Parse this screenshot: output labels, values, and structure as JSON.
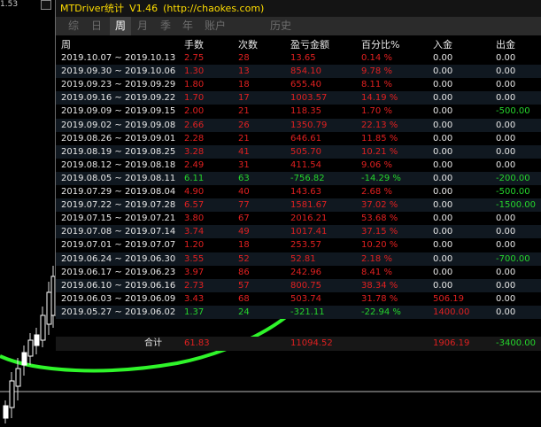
{
  "chart": {
    "price_label": "1.53"
  },
  "window": {
    "app_name": "MTDriver统计",
    "version": "V1.46",
    "url": "(http://chaokes.com)"
  },
  "tabs": [
    {
      "label": "综",
      "active": false
    },
    {
      "label": "日",
      "active": false
    },
    {
      "label": "周",
      "active": true
    },
    {
      "label": "月",
      "active": false
    },
    {
      "label": "季",
      "active": false
    },
    {
      "label": "年",
      "active": false
    },
    {
      "label": "账户",
      "active": false
    },
    {
      "label": "历史",
      "active": false
    }
  ],
  "table": {
    "headers": [
      "周",
      "手数",
      "次数",
      "盈亏金额",
      "百分比%",
      "入金",
      "出金"
    ],
    "rows": [
      {
        "period": "2019.10.07 ~ 2019.10.13",
        "lots": "2.75",
        "count": "28",
        "profit": "13.65",
        "pct": "0.14 %",
        "deposit": "0.00",
        "withdraw": "0.00",
        "sign": "pos"
      },
      {
        "period": "2019.09.30 ~ 2019.10.06",
        "lots": "1.30",
        "count": "13",
        "profit": "854.10",
        "pct": "9.78 %",
        "deposit": "0.00",
        "withdraw": "0.00",
        "sign": "pos"
      },
      {
        "period": "2019.09.23 ~ 2019.09.29",
        "lots": "1.80",
        "count": "18",
        "profit": "655.40",
        "pct": "8.11 %",
        "deposit": "0.00",
        "withdraw": "0.00",
        "sign": "pos"
      },
      {
        "period": "2019.09.16 ~ 2019.09.22",
        "lots": "1.70",
        "count": "17",
        "profit": "1003.57",
        "pct": "14.19 %",
        "deposit": "0.00",
        "withdraw": "0.00",
        "sign": "pos"
      },
      {
        "period": "2019.09.09 ~ 2019.09.15",
        "lots": "2.00",
        "count": "21",
        "profit": "118.35",
        "pct": "1.70 %",
        "deposit": "0.00",
        "withdraw": "-500.00",
        "sign": "pos"
      },
      {
        "period": "2019.09.02 ~ 2019.09.08",
        "lots": "2.66",
        "count": "26",
        "profit": "1350.79",
        "pct": "22.13 %",
        "deposit": "0.00",
        "withdraw": "0.00",
        "sign": "pos"
      },
      {
        "period": "2019.08.26 ~ 2019.09.01",
        "lots": "2.28",
        "count": "21",
        "profit": "646.61",
        "pct": "11.85 %",
        "deposit": "0.00",
        "withdraw": "0.00",
        "sign": "pos"
      },
      {
        "period": "2019.08.19 ~ 2019.08.25",
        "lots": "3.28",
        "count": "41",
        "profit": "505.70",
        "pct": "10.21 %",
        "deposit": "0.00",
        "withdraw": "0.00",
        "sign": "pos"
      },
      {
        "period": "2019.08.12 ~ 2019.08.18",
        "lots": "2.49",
        "count": "31",
        "profit": "411.54",
        "pct": "9.06 %",
        "deposit": "0.00",
        "withdraw": "0.00",
        "sign": "pos"
      },
      {
        "period": "2019.08.05 ~ 2019.08.11",
        "lots": "6.11",
        "count": "63",
        "profit": "-756.82",
        "pct": "-14.29 %",
        "deposit": "0.00",
        "withdraw": "-200.00",
        "sign": "neg"
      },
      {
        "period": "2019.07.29 ~ 2019.08.04",
        "lots": "4.90",
        "count": "40",
        "profit": "143.63",
        "pct": "2.68 %",
        "deposit": "0.00",
        "withdraw": "-500.00",
        "sign": "pos"
      },
      {
        "period": "2019.07.22 ~ 2019.07.28",
        "lots": "6.57",
        "count": "77",
        "profit": "1581.67",
        "pct": "37.02 %",
        "deposit": "0.00",
        "withdraw": "-1500.00",
        "sign": "pos"
      },
      {
        "period": "2019.07.15 ~ 2019.07.21",
        "lots": "3.80",
        "count": "67",
        "profit": "2016.21",
        "pct": "53.68 %",
        "deposit": "0.00",
        "withdraw": "0.00",
        "sign": "pos"
      },
      {
        "period": "2019.07.08 ~ 2019.07.14",
        "lots": "3.74",
        "count": "49",
        "profit": "1017.41",
        "pct": "37.15 %",
        "deposit": "0.00",
        "withdraw": "0.00",
        "sign": "pos"
      },
      {
        "period": "2019.07.01 ~ 2019.07.07",
        "lots": "1.20",
        "count": "18",
        "profit": "253.57",
        "pct": "10.20 %",
        "deposit": "0.00",
        "withdraw": "0.00",
        "sign": "pos"
      },
      {
        "period": "2019.06.24 ~ 2019.06.30",
        "lots": "3.55",
        "count": "52",
        "profit": "52.81",
        "pct": "2.18 %",
        "deposit": "0.00",
        "withdraw": "-700.00",
        "sign": "pos"
      },
      {
        "period": "2019.06.17 ~ 2019.06.23",
        "lots": "3.97",
        "count": "86",
        "profit": "242.96",
        "pct": "8.41 %",
        "deposit": "0.00",
        "withdraw": "0.00",
        "sign": "pos"
      },
      {
        "period": "2019.06.10 ~ 2019.06.16",
        "lots": "2.73",
        "count": "57",
        "profit": "800.75",
        "pct": "38.34 %",
        "deposit": "0.00",
        "withdraw": "0.00",
        "sign": "pos"
      },
      {
        "period": "2019.06.03 ~ 2019.06.09",
        "lots": "3.43",
        "count": "68",
        "profit": "503.74",
        "pct": "31.78 %",
        "deposit": "506.19",
        "withdraw": "0.00",
        "sign": "pos"
      },
      {
        "period": "2019.05.27 ~ 2019.06.02",
        "lots": "1.37",
        "count": "24",
        "profit": "-321.11",
        "pct": "-22.94 %",
        "deposit": "1400.00",
        "withdraw": "0.00",
        "sign": "neg"
      }
    ],
    "total": {
      "label": "合计",
      "lots": "61.83",
      "count": "",
      "profit": "11094.52",
      "pct": "",
      "deposit": "1906.19",
      "withdraw": "-3400.00"
    }
  },
  "colors": {
    "positive": "#e02020",
    "negative": "#25d52c",
    "neutral": "#e8e8e8",
    "title": "#ffdd00",
    "equity_line": "#2ff52a"
  }
}
